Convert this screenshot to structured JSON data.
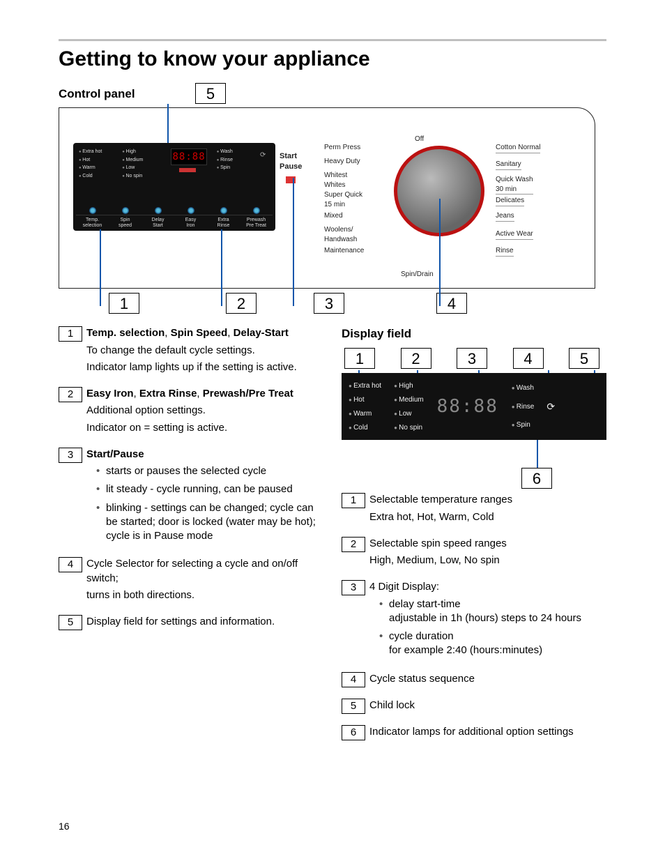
{
  "page_number": "16",
  "heading": "Getting to know your appliance",
  "section_control_panel": "Control panel",
  "section_display_field": "Display field",
  "panel": {
    "temp": [
      "Extra hot",
      "Hot",
      "Warm",
      "Cold"
    ],
    "spin": [
      "High",
      "Medium",
      "Low",
      "No spin"
    ],
    "status": [
      "Wash",
      "Rinse",
      "Spin"
    ],
    "led": "88:88",
    "buttons": [
      "Temp.\nselection",
      "Spin\nspeed",
      "Delay\nStart",
      "Easy\nIron",
      "Extra\nRinse",
      "Prewash\nPre Treat"
    ],
    "start": "Start",
    "pause": "Pause"
  },
  "knob_left": [
    "Perm Press",
    "Heavy Duty",
    "Whitest\nWhites",
    "Super Quick\n15 min",
    "Mixed",
    "Woolens/\nHandwash",
    "Maintenance"
  ],
  "knob_top": "Off",
  "knob_bottom": "Spin/Drain",
  "knob_right": [
    "Cotton Normal",
    "Sanitary",
    "Quick Wash\n30 min",
    "Delicates",
    "Jeans",
    "Active Wear",
    "Rinse"
  ],
  "callouts": {
    "c1": "1",
    "c2": "2",
    "c3": "3",
    "c4": "4",
    "c5": "5"
  },
  "legend_cp": [
    {
      "n": "1",
      "title": "Temp. selection, Spin Speed, Delay-Start",
      "lines": [
        "To change the default cycle settings.",
        "Indicator lamp lights up if the setting is active."
      ]
    },
    {
      "n": "2",
      "title": "Easy Iron, Extra Rinse, Prewash/Pre Treat",
      "lines": [
        "Additional option settings.",
        "Indicator on = setting is active."
      ]
    },
    {
      "n": "3",
      "title": "Start/Pause",
      "bullets": [
        "starts or pauses the selected cycle",
        "lit steady - cycle running, can be paused",
        "blinking - settings can be changed; cycle can be started; door is locked (water may be hot); cycle is in Pause mode"
      ]
    },
    {
      "n": "4",
      "plain": [
        "Cycle Selector for selecting a cycle and on/off switch;",
        "turns in both directions."
      ]
    },
    {
      "n": "5",
      "plain": [
        "Display field for settings and information."
      ]
    }
  ],
  "display": {
    "nums": [
      "1",
      "2",
      "3",
      "4",
      "5"
    ],
    "n6": "6",
    "temp": [
      "Extra hot",
      "Hot",
      "Warm",
      "Cold"
    ],
    "spin": [
      "High",
      "Medium",
      "Low",
      "No spin"
    ],
    "status": [
      "Wash",
      "Rinse",
      "Spin"
    ],
    "led": "88:88"
  },
  "legend_df": [
    {
      "n": "1",
      "plain": [
        "Selectable temperature ranges",
        "Extra hot, Hot, Warm, Cold"
      ]
    },
    {
      "n": "2",
      "plain": [
        "Selectable spin speed ranges",
        "High, Medium, Low, No spin"
      ]
    },
    {
      "n": "3",
      "plain": [
        "4 Digit Display:"
      ],
      "bullets": [
        "delay start-time\nadjustable in 1h (hours) steps to 24 hours",
        "cycle duration\nfor example 2:40 (hours:minutes)"
      ]
    },
    {
      "n": "4",
      "plain": [
        "Cycle status sequence"
      ]
    },
    {
      "n": "5",
      "plain": [
        "Child lock"
      ]
    },
    {
      "n": "6",
      "plain": [
        "Indicator lamps for additional option settings"
      ]
    }
  ]
}
